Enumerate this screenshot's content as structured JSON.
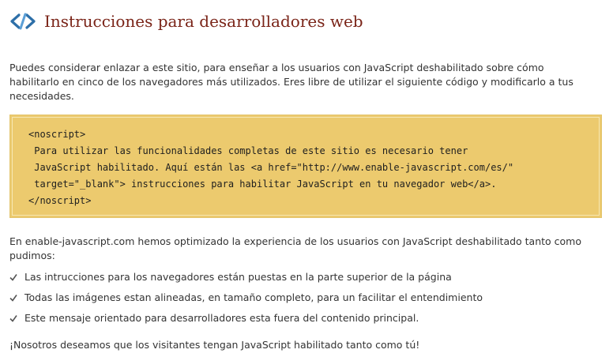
{
  "header": {
    "title": "Instrucciones para desarrolladores web",
    "icon": "code-brackets-icon",
    "accent_color": "#7a2418",
    "icon_color": "#2d6fa8"
  },
  "intro": {
    "text": "Puedes considerar enlazar a este sitio, para enseñar a los usuarios con JavaScript deshabilitado sobre cómo habilitarlo en cinco de los navegadores más utilizados. Eres libre de utilizar el siguiente código y modificarlo a tus necesidades."
  },
  "code_block": {
    "background": "#ecca6e",
    "text": "<noscript>\n Para utilizar las funcionalidades completas de este sitio es necesario tener\n JavaScript habilitado. Aquí están las <a href=\"http://www.enable-javascript.com/es/\"\n target=\"_blank\"> instrucciones para habilitar JavaScript en tu navegador web</a>.\n</noscript>"
  },
  "optimization": {
    "text": "En enable-javascript.com hemos optimizado la experiencia de los usuarios con JavaScript deshabilitado tanto como pudimos:",
    "items": [
      {
        "icon": "check-icon",
        "label": "Las intrucciones para los navegadores están puestas en la parte superior de la página"
      },
      {
        "icon": "check-icon",
        "label": "Todas las imágenes estan alineadas, en tamaño completo, para un facilitar el entendimiento"
      },
      {
        "icon": "check-icon",
        "label": "Este mensaje orientado para desarrolladores esta fuera del contenido principal."
      }
    ]
  },
  "closing": {
    "text": "¡Nosotros deseamos que los visitantes tengan JavaScript habilitado tanto como tú!"
  }
}
